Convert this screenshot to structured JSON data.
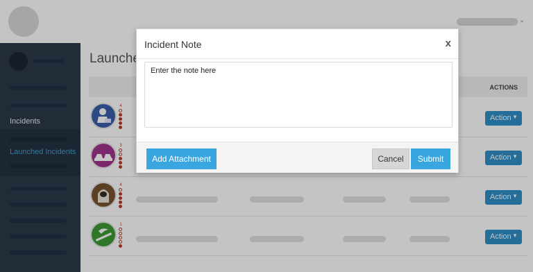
{
  "sidebar": {
    "items": [
      {
        "label": "Incidents"
      },
      {
        "label": "Launched Incidents"
      }
    ]
  },
  "main": {
    "title": "Launche",
    "table": {
      "actions_header": "ACTIONS",
      "rows": [
        {
          "icon": "person-at-desk-icon",
          "icon_color": "#3a5fa8",
          "severity": "4",
          "action_label": "Action"
        },
        {
          "icon": "car-collision-icon",
          "icon_color": "#a0338f",
          "severity": "3",
          "action_label": "Action"
        },
        {
          "icon": "hooded-figure-icon",
          "icon_color": "#7a5230",
          "severity": "4",
          "action_label": "Action"
        },
        {
          "icon": "fallen-tree-icon",
          "icon_color": "#3f9a35",
          "severity": "1",
          "action_label": "Action"
        }
      ]
    }
  },
  "modal": {
    "title": "Incident Note",
    "close_label": "x",
    "note_placeholder": "Enter the note here",
    "add_attachment_label": "Add Attachment",
    "cancel_label": "Cancel",
    "submit_label": "Submit"
  },
  "colors": {
    "sidebar_bg": "#2b3a4a",
    "accent": "#3aa6e0",
    "action_button": "#2f8fc7",
    "severity": "#c0392b"
  }
}
